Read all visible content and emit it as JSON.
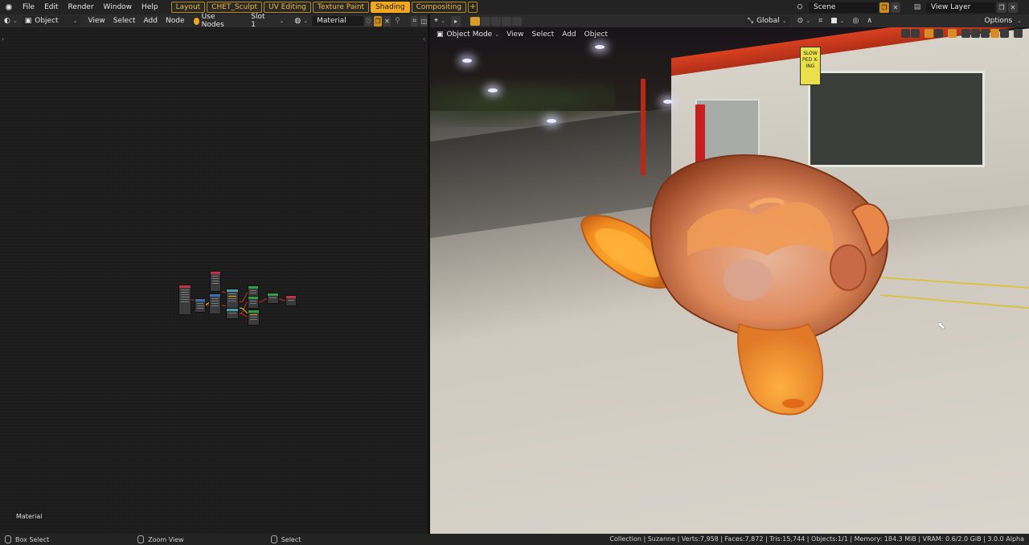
{
  "menu": {
    "items": [
      "File",
      "Edit",
      "Render",
      "Window",
      "Help"
    ]
  },
  "workspaces": [
    {
      "label": "Layout",
      "active": false
    },
    {
      "label": "CHET_Sculpt",
      "active": false
    },
    {
      "label": "UV Editing",
      "active": false
    },
    {
      "label": "Texture Paint",
      "active": false
    },
    {
      "label": "Shading",
      "active": true
    },
    {
      "label": "Compositing",
      "active": false
    }
  ],
  "workspace_add": "+",
  "top_right": {
    "scene": "Scene",
    "view_layer": "View Layer"
  },
  "node_editor": {
    "object_dropdown": "Object",
    "menus": [
      "View",
      "Select",
      "Add",
      "Node"
    ],
    "use_nodes": "Use Nodes",
    "slot": "Slot 1",
    "material": "Material",
    "footer_label": "Material"
  },
  "viewport": {
    "orientation": "Global",
    "options": "Options",
    "mode": "Object Mode",
    "menus": [
      "View",
      "Select",
      "Add",
      "Object"
    ],
    "sign_text": "SLOW PED X-ING"
  },
  "statusbar": {
    "left": [
      "Box Select",
      "Zoom View",
      "Select"
    ],
    "right": "Collection | Suzanne | Verts:7,958 | Faces:7,872 | Tris:15,744 | Objects:1/1 | Memory: 184.3 MiB | VRAM: 0.6/2.0 GiB | 3.0.0 Alpha"
  },
  "colors": {
    "accent": "#f0a820",
    "header_bg": "#2b2b2b",
    "topbar_bg": "#232323",
    "monkey_orange": "#f08a30"
  }
}
